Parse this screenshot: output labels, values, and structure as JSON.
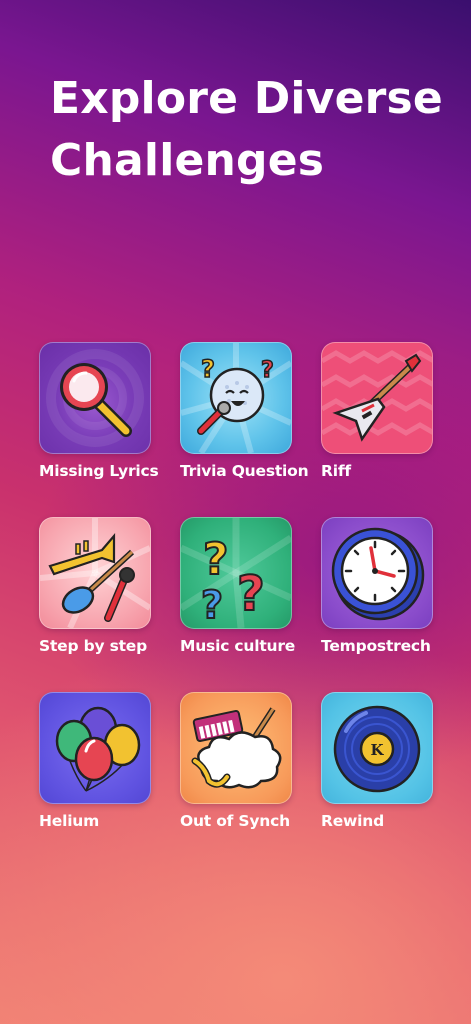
{
  "heading": {
    "line1": "Explore Diverse",
    "line2": "Challenges"
  },
  "challenges": [
    {
      "label": "Missing Lyrics",
      "icon": "magnifier-icon"
    },
    {
      "label": "Trivia Question",
      "icon": "singing-ball-icon"
    },
    {
      "label": "Riff",
      "icon": "electric-guitar-icon"
    },
    {
      "label": "Step by step",
      "icon": "instruments-icon"
    },
    {
      "label": "Music culture",
      "icon": "question-marks-icon"
    },
    {
      "label": "Tempostrech",
      "icon": "clock-icon"
    },
    {
      "label": "Helium",
      "icon": "balloons-icon"
    },
    {
      "label": "Out of Synch",
      "icon": "instruments-cloud-icon"
    },
    {
      "label": "Rewind",
      "icon": "vinyl-record-icon"
    }
  ],
  "record_letter": "K"
}
